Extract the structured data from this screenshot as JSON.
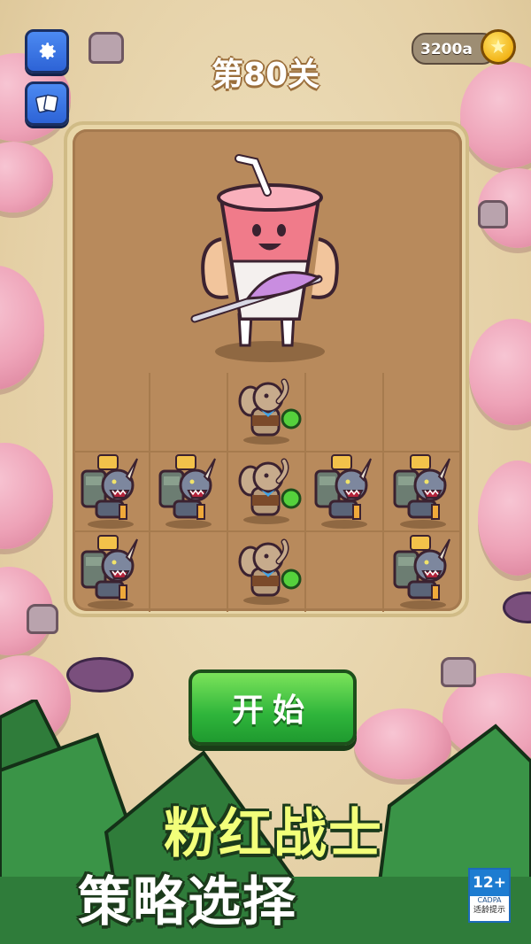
{
  "level": {
    "title": "第80关"
  },
  "currency": {
    "amount": "3200a",
    "icon": "gold-coin-icon"
  },
  "buttons": {
    "settings_icon": "gear-icon",
    "cards_icon": "cards-icon",
    "start_label": "开始"
  },
  "board": {
    "boss": {
      "name": "boss-milkshake-fighter"
    },
    "grid": {
      "columns": 5,
      "rows": 3
    },
    "units": [
      {
        "row": 0,
        "col": 2,
        "type": "elephant"
      },
      {
        "row": 1,
        "col": 0,
        "type": "rhino"
      },
      {
        "row": 1,
        "col": 1,
        "type": "rhino"
      },
      {
        "row": 1,
        "col": 2,
        "type": "elephant"
      },
      {
        "row": 1,
        "col": 3,
        "type": "rhino"
      },
      {
        "row": 1,
        "col": 4,
        "type": "rhino"
      },
      {
        "row": 2,
        "col": 0,
        "type": "rhino"
      },
      {
        "row": 2,
        "col": 2,
        "type": "elephant"
      },
      {
        "row": 2,
        "col": 4,
        "type": "rhino"
      }
    ]
  },
  "promo": {
    "line1": "粉红战士",
    "line2": "策略选择"
  },
  "age_rating": {
    "label": "12+",
    "org": "CADPA",
    "note": "适龄提示"
  },
  "colors": {
    "accent": "#2fb53b",
    "board": "#b88a5c",
    "tree": "#eea3b8"
  }
}
